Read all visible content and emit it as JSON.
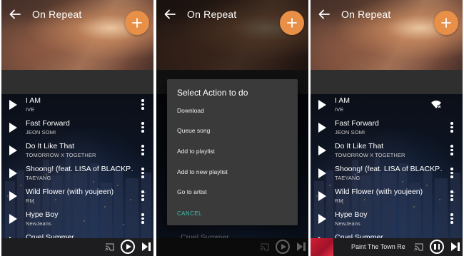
{
  "header": {
    "title": "On Repeat"
  },
  "songs": [
    {
      "title": "I AM",
      "artist": "IVE"
    },
    {
      "title": "Fast Forward",
      "artist": "JEON SOMI"
    },
    {
      "title": "Do It Like That",
      "artist": "TOMORROW X TOGETHER"
    },
    {
      "title": "Shoong! (feat. LISA of BLACKP…",
      "artist": "TAEYANG"
    },
    {
      "title": "Wild Flower (with youjeen)",
      "artist": "RM"
    },
    {
      "title": "Hype Boy",
      "artist": "NewJeans"
    },
    {
      "title": "Cruel Summer",
      "artist": ""
    }
  ],
  "dialog": {
    "title": "Select Action to do",
    "items": [
      "Download",
      "Queue song",
      "Add to playlist",
      "Add to new playlist",
      "Go to artist"
    ],
    "cancel": "CANCEL"
  },
  "now_playing": {
    "title": "Paint The Town Re"
  },
  "icons": {
    "back": "arrow-left-icon",
    "add": "plus-icon",
    "play": "play-icon",
    "more": "more-vert-icon",
    "cast": "cast-icon",
    "skip": "skip-next-icon",
    "pause": "pause-icon",
    "offline": "wifi-offline-icon"
  },
  "colors": {
    "accent": "#e88f48",
    "cancel": "#3fc1b0",
    "dialog_bg": "#3a3a3a"
  }
}
